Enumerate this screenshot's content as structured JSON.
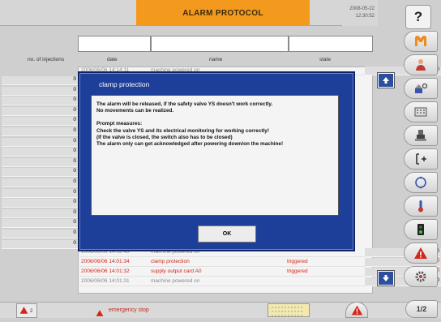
{
  "header": {
    "title": "ALARM PROTOCOL",
    "date": "2008-05-22",
    "time": "12:30:52",
    "help_label": "?"
  },
  "columns": {
    "injections": "no. of injections",
    "date": "date",
    "name": "name",
    "state": "state"
  },
  "rows_top": [
    {
      "num": "0",
      "date": "2006/06/06 14:14:11",
      "name": "machine powered on",
      "state": "",
      "color": "grey"
    }
  ],
  "row_numbers_mid": [
    "0",
    "0",
    "0",
    "0",
    "0",
    "0",
    "0",
    "0",
    "0",
    "0",
    "0",
    "0",
    "0",
    "0",
    "0",
    "0",
    "0"
  ],
  "rows_bottom": [
    {
      "num": "0",
      "date": "2006/06/06 14:02:48",
      "name": "machine powered on",
      "state": "",
      "color": "grey"
    },
    {
      "num": "0",
      "date": "2006/06/06 14:01:34",
      "name": "clamp protection",
      "state": "triggered",
      "color": "red"
    },
    {
      "num": "0",
      "date": "2006/06/06 14:01:32",
      "name": "supply output card A0",
      "state": "triggered",
      "color": "red"
    },
    {
      "num": "0",
      "date": "2006/06/06 14:01:31",
      "name": "machine powered on",
      "state": "",
      "color": "grey"
    }
  ],
  "dialog": {
    "title": "clamp protection",
    "line1": "The alarm will be released, if the safety valve YS doesn't work correctly.",
    "line2": "No movements can be realized.",
    "measures_heading": "Prompt measures:",
    "measure1": "Check the valve YS and its electrical monitoring for working correctly!",
    "measure2": "(If the valve is closed, the switch also has to be closed)",
    "measure3": "The alarm only can get acknowledged after powering down/on the machine!",
    "ok_label": "OK"
  },
  "status": {
    "alarm_count": "2",
    "emergency_text": "emergency stop",
    "page_indicator": "1/2"
  },
  "sidebar_icons": [
    "m-logo-icon",
    "operator-icon",
    "mold-icon",
    "keyboard-icon",
    "injection-unit-icon",
    "ejector-icon",
    "cycle-icon",
    "temperature-icon",
    "io-status-icon",
    "alarm-icon",
    "settings-icon"
  ],
  "colors": {
    "accent": "#f39a1e",
    "dialog_blue": "#1d3f99",
    "alarm_red": "#d3261a"
  }
}
